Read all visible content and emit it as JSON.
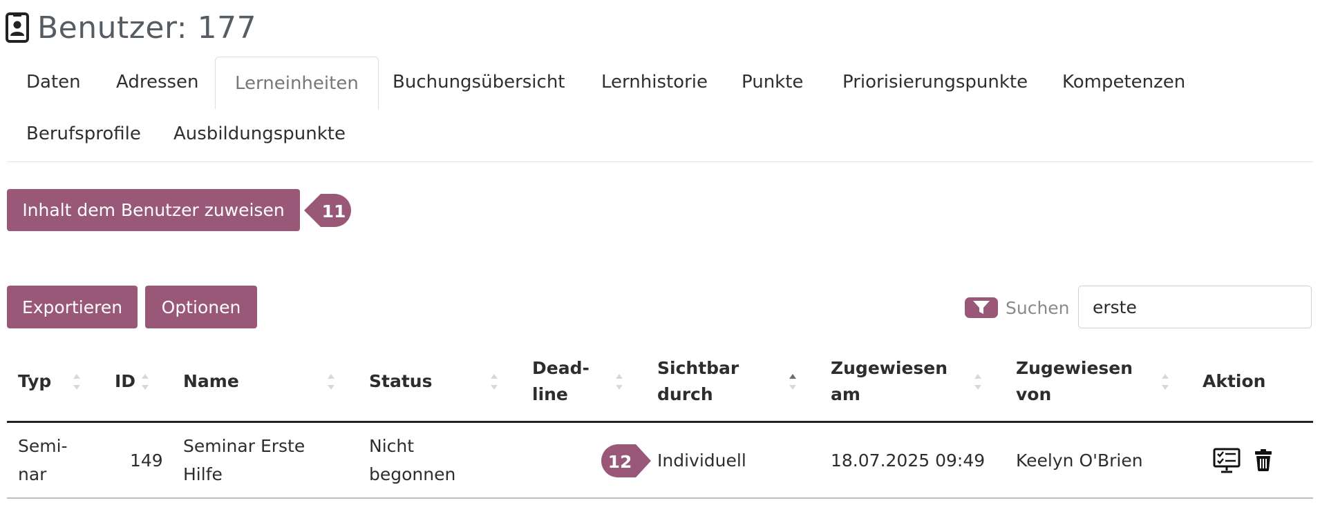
{
  "page": {
    "title": "Benutzer: 177",
    "title_icon": "contact-card-icon"
  },
  "tabs": [
    {
      "label": "Daten"
    },
    {
      "label": "Adressen"
    },
    {
      "label": "Lerneinheiten",
      "active": true
    },
    {
      "label": "Buchungsübersicht"
    },
    {
      "label": "Lernhistorie"
    },
    {
      "label": "Punkte"
    },
    {
      "label": "Priorisierungspunkte"
    },
    {
      "label": "Kompetenzen"
    },
    {
      "label": "Berufsprofile"
    },
    {
      "label": "Ausbildungspunkte"
    }
  ],
  "assign_button": {
    "label": "Inhalt dem Benutzer zuweisen"
  },
  "markers": {
    "m1": "11",
    "m2": "12"
  },
  "toolbar": {
    "export_label": "Exportieren",
    "options_label": "Optionen"
  },
  "search": {
    "label": "Suchen",
    "value": "erste",
    "icon": "filter-icon"
  },
  "table": {
    "headers": {
      "typ": "Typ",
      "id": "ID",
      "name": "Name",
      "status": "Status",
      "deadline_1": "Dead-",
      "deadline_2": "line",
      "sichtbar_1": "Sichtbar",
      "sichtbar_2": "durch",
      "zugewiesen_am_1": "Zugewiesen",
      "zugewiesen_am_2": "am",
      "zugewiesen_von_1": "Zugewiesen",
      "zugewiesen_von_2": "von",
      "aktion": "Aktion"
    },
    "sorted_column": "Sichtbar durch",
    "rows": [
      {
        "typ_1": "Semi-",
        "typ_2": "nar",
        "id": "149",
        "name_1": "Seminar Erste",
        "name_2": "Hilfe",
        "status_1": "Nicht",
        "status_2": "begonnen",
        "deadline": "",
        "sichtbar": "Individuell",
        "zugewiesen_am": "18.07.2025 09:49",
        "zugewiesen_von": "Keelyn O'Brien",
        "actions": [
          "checklist-monitor-icon",
          "trash-icon"
        ]
      }
    ]
  },
  "colors": {
    "accent": "#9a5878",
    "text": "#2d2d2d",
    "muted": "#8a8a8a"
  }
}
